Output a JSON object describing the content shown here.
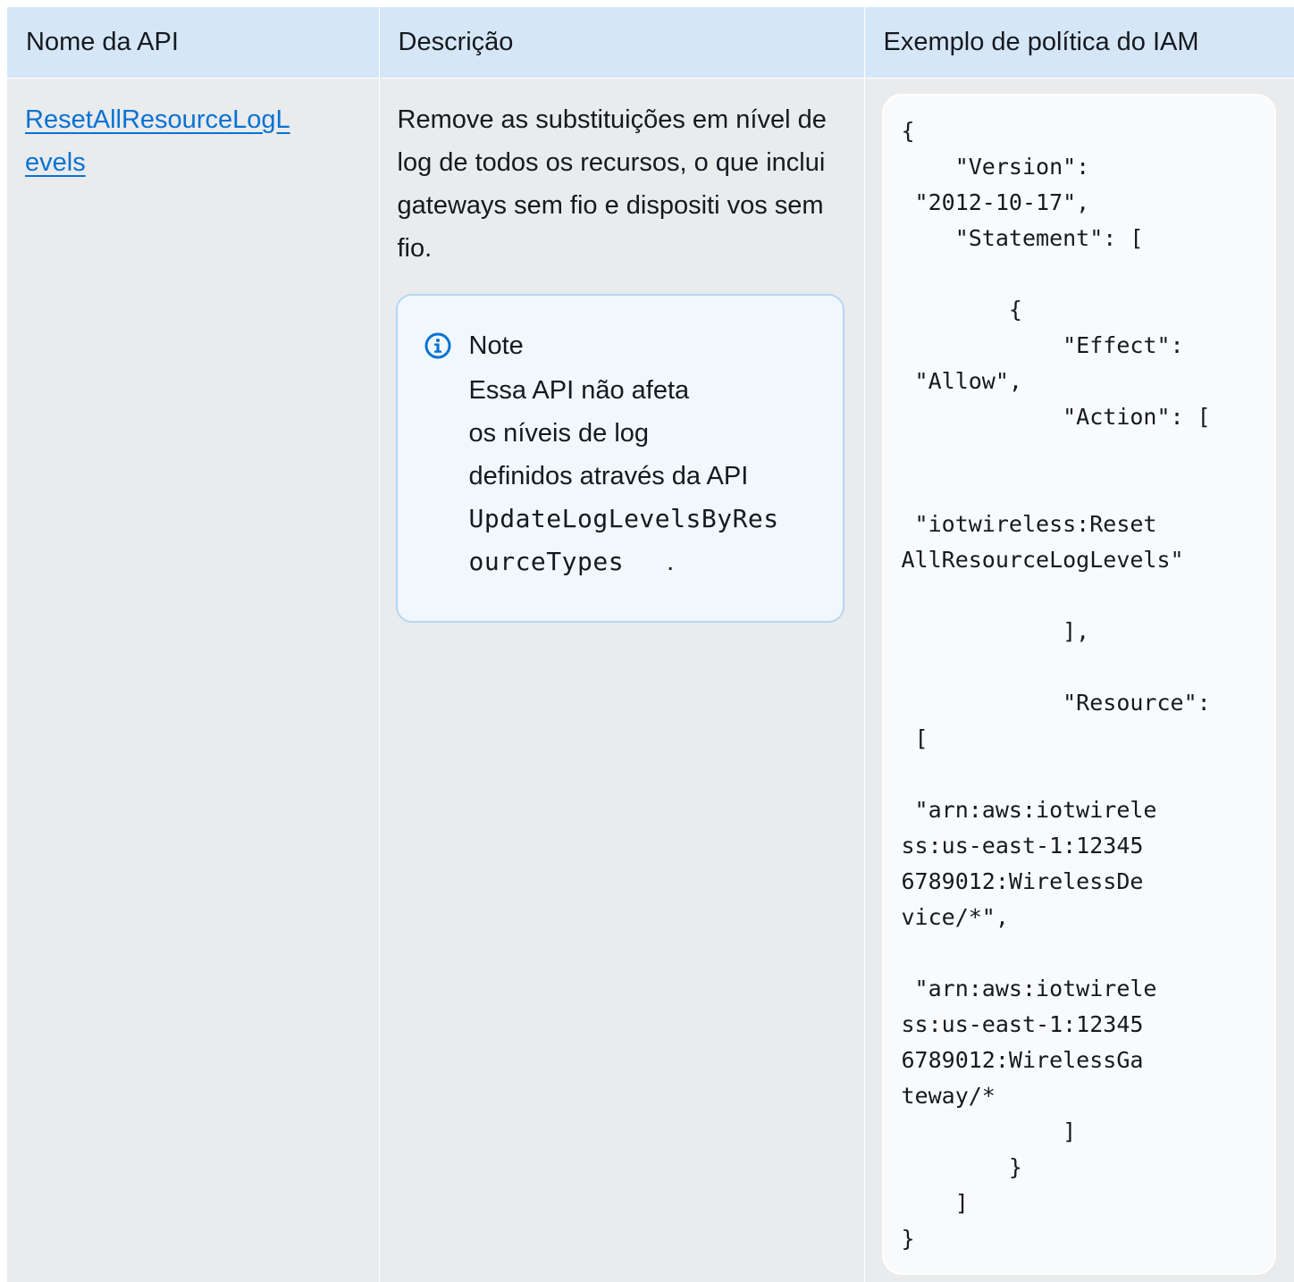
{
  "table": {
    "headers": {
      "name": "Nome da API",
      "description": "Descrição",
      "policy": "Exemplo de política do IAM"
    },
    "row": {
      "api_name": "ResetAllResourceLogLevels",
      "description": "Remove as substituições em nível de log de todos os recursos, o que inclui gateways sem fio e dispositi vos sem fio.",
      "note": {
        "icon": "info-icon",
        "title": "Note",
        "line1": "Essa API não afeta",
        "line2": "os níveis de log",
        "line3": "definidos através da API",
        "code": "UpdateLogLevelsByResourceTypes",
        "trailing": "."
      },
      "policy_code": "{\n    \"Version\":\n \"2012-10-17\",\n    \"Statement\": [\n\n        {\n            \"Effect\":\n \"Allow\",\n            \"Action\": [\n\n\n \"iotwireless:Reset\nAllResourceLogLevels\"\n\n            ],\n\n            \"Resource\":\n [\n\n \"arn:aws:iotwirele\nss:us-east-1:12345\n6789012:WirelessDe\nvice/*\",\n\n \"arn:aws:iotwirele\nss:us-east-1:12345\n6789012:WirelessGa\nteway/*\n            ]\n        }\n    ]\n}"
    }
  },
  "colors": {
    "header_bg": "#d5e7f7",
    "cell_bg": "#e9ebed",
    "link": "#0972d3",
    "note_border": "#b5d6f4",
    "note_bg": "#f1f8fd",
    "icon": "#0972d3"
  }
}
